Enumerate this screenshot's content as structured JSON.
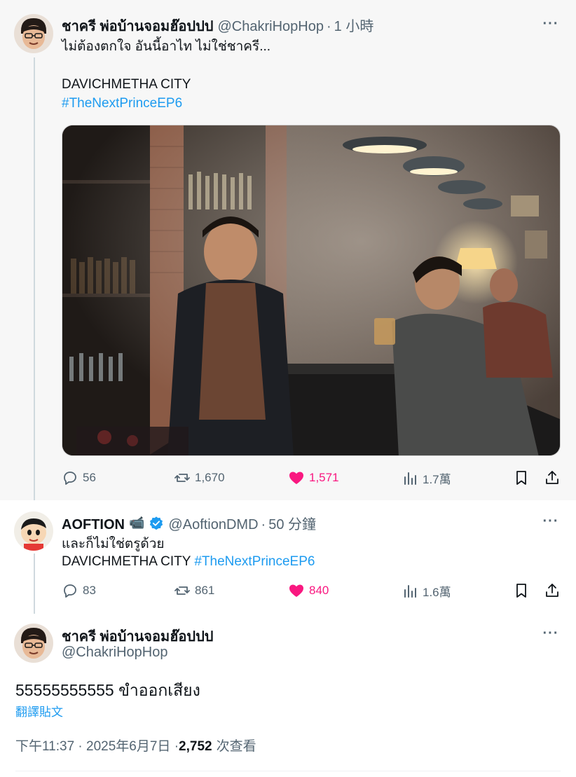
{
  "quoted_tweet": {
    "author_name": "ชาครี พ่อบ้านจอมฮ๊อปปป",
    "handle": "@ChakriHopHop",
    "separator": "·",
    "time": "1 小時",
    "text_line1": "ไม่ต้องตกใจ อันนี้อาไท ไม่ใช่ชาครี...",
    "text_line2": "DAVICHMETHA CITY",
    "hashtag": "#TheNextPrinceEP6",
    "replies": "56",
    "retweets": "1,670",
    "likes": "1,571",
    "views": "1.7萬"
  },
  "reply_tweet": {
    "author_name": "AOFTION",
    "author_emoji": "📹",
    "handle": "@AoftionDMD",
    "separator": "·",
    "time": "50 分鐘",
    "text_line1": "และก็ไม่ใช่ตรูด้วย",
    "text_line2": "DAVICHMETHA CITY",
    "hashtag": "#TheNextPrinceEP6",
    "replies": "83",
    "retweets": "861",
    "likes": "840",
    "views": "1.6萬"
  },
  "main_tweet": {
    "author_name": "ชาครี พ่อบ้านจอมฮ๊อปปป",
    "handle": "@ChakriHopHop",
    "text": "55555555555 ขำออกเสียง",
    "translate_label": "翻譯貼文",
    "timestamp": "下午11:37 · 2025年6月7日 · ",
    "view_count": "2,752",
    "view_label": "次查看"
  },
  "colors": {
    "accent": "#1d9bf0",
    "like": "#f91880",
    "muted": "#536471",
    "verified": "#1d9bf0"
  },
  "icons": [
    "more-icon",
    "reply-icon",
    "retweet-icon",
    "like-icon",
    "views-icon",
    "bookmark-icon",
    "share-icon",
    "verified-icon",
    "camera-icon"
  ]
}
